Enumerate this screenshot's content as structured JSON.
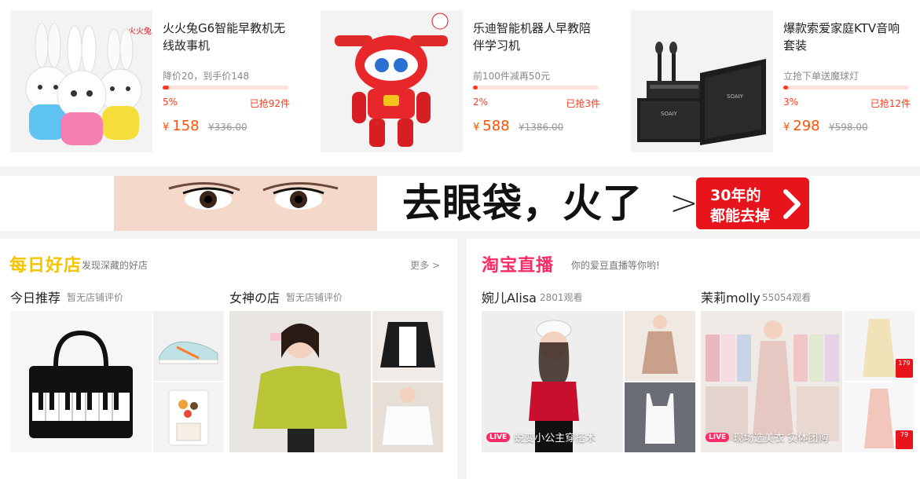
{
  "products": [
    {
      "name": "火火兔G6智能早教机无线故事机",
      "promo": "降价20，到手价148",
      "progress": 0.05,
      "progress_label": "5%",
      "sold": "已抢92件",
      "price_symbol": "¥",
      "price": "158",
      "old_price": "¥336.00"
    },
    {
      "name": "乐迪智能机器人早教陪伴学习机",
      "promo": "前100件减再50元",
      "progress": 0.02,
      "progress_label": "2%",
      "sold": "已抢3件",
      "price_symbol": "¥",
      "price": "588",
      "old_price": "¥1386.00"
    },
    {
      "name": "爆款索爱家庭KTV音响套装",
      "promo": "立抢下单送魔球灯",
      "progress": 0.03,
      "progress_label": "3%",
      "sold": "已抢12件",
      "price_symbol": "¥",
      "price": "298",
      "old_price": "¥598.00"
    }
  ],
  "banner": {
    "headline": "去眼袋，火了",
    "arrow": ">",
    "cta_line1": "30年的",
    "cta_line2": "都能去掉"
  },
  "good_shops": {
    "logo": "每日好店",
    "tagline": "发现深藏的好店",
    "more": "更多 >",
    "columns": [
      {
        "title": "今日推荐",
        "sub": "暂无店铺评价"
      },
      {
        "title": "女神の店",
        "sub": "暂无店铺评价"
      }
    ]
  },
  "live": {
    "logo": "淘宝直播",
    "tagline": "你的爱豆直播等你哟!",
    "badge": "LIVE",
    "columns": [
      {
        "title": "婉儿Alisa",
        "views": "2801观看",
        "caption": "蜕变小公主穿搭术"
      },
      {
        "title": "茉莉molly",
        "views": "55054观看",
        "caption": "现场选美衣 实体团购"
      }
    ],
    "price_tags": [
      "179",
      "79"
    ]
  },
  "colors": {
    "accent_red": "#ff3b1f",
    "price_orange": "#ff5000",
    "good_shops_yellow": "#f5c400",
    "live_pink": "#ff2a66",
    "cta_red": "#e8141c"
  }
}
